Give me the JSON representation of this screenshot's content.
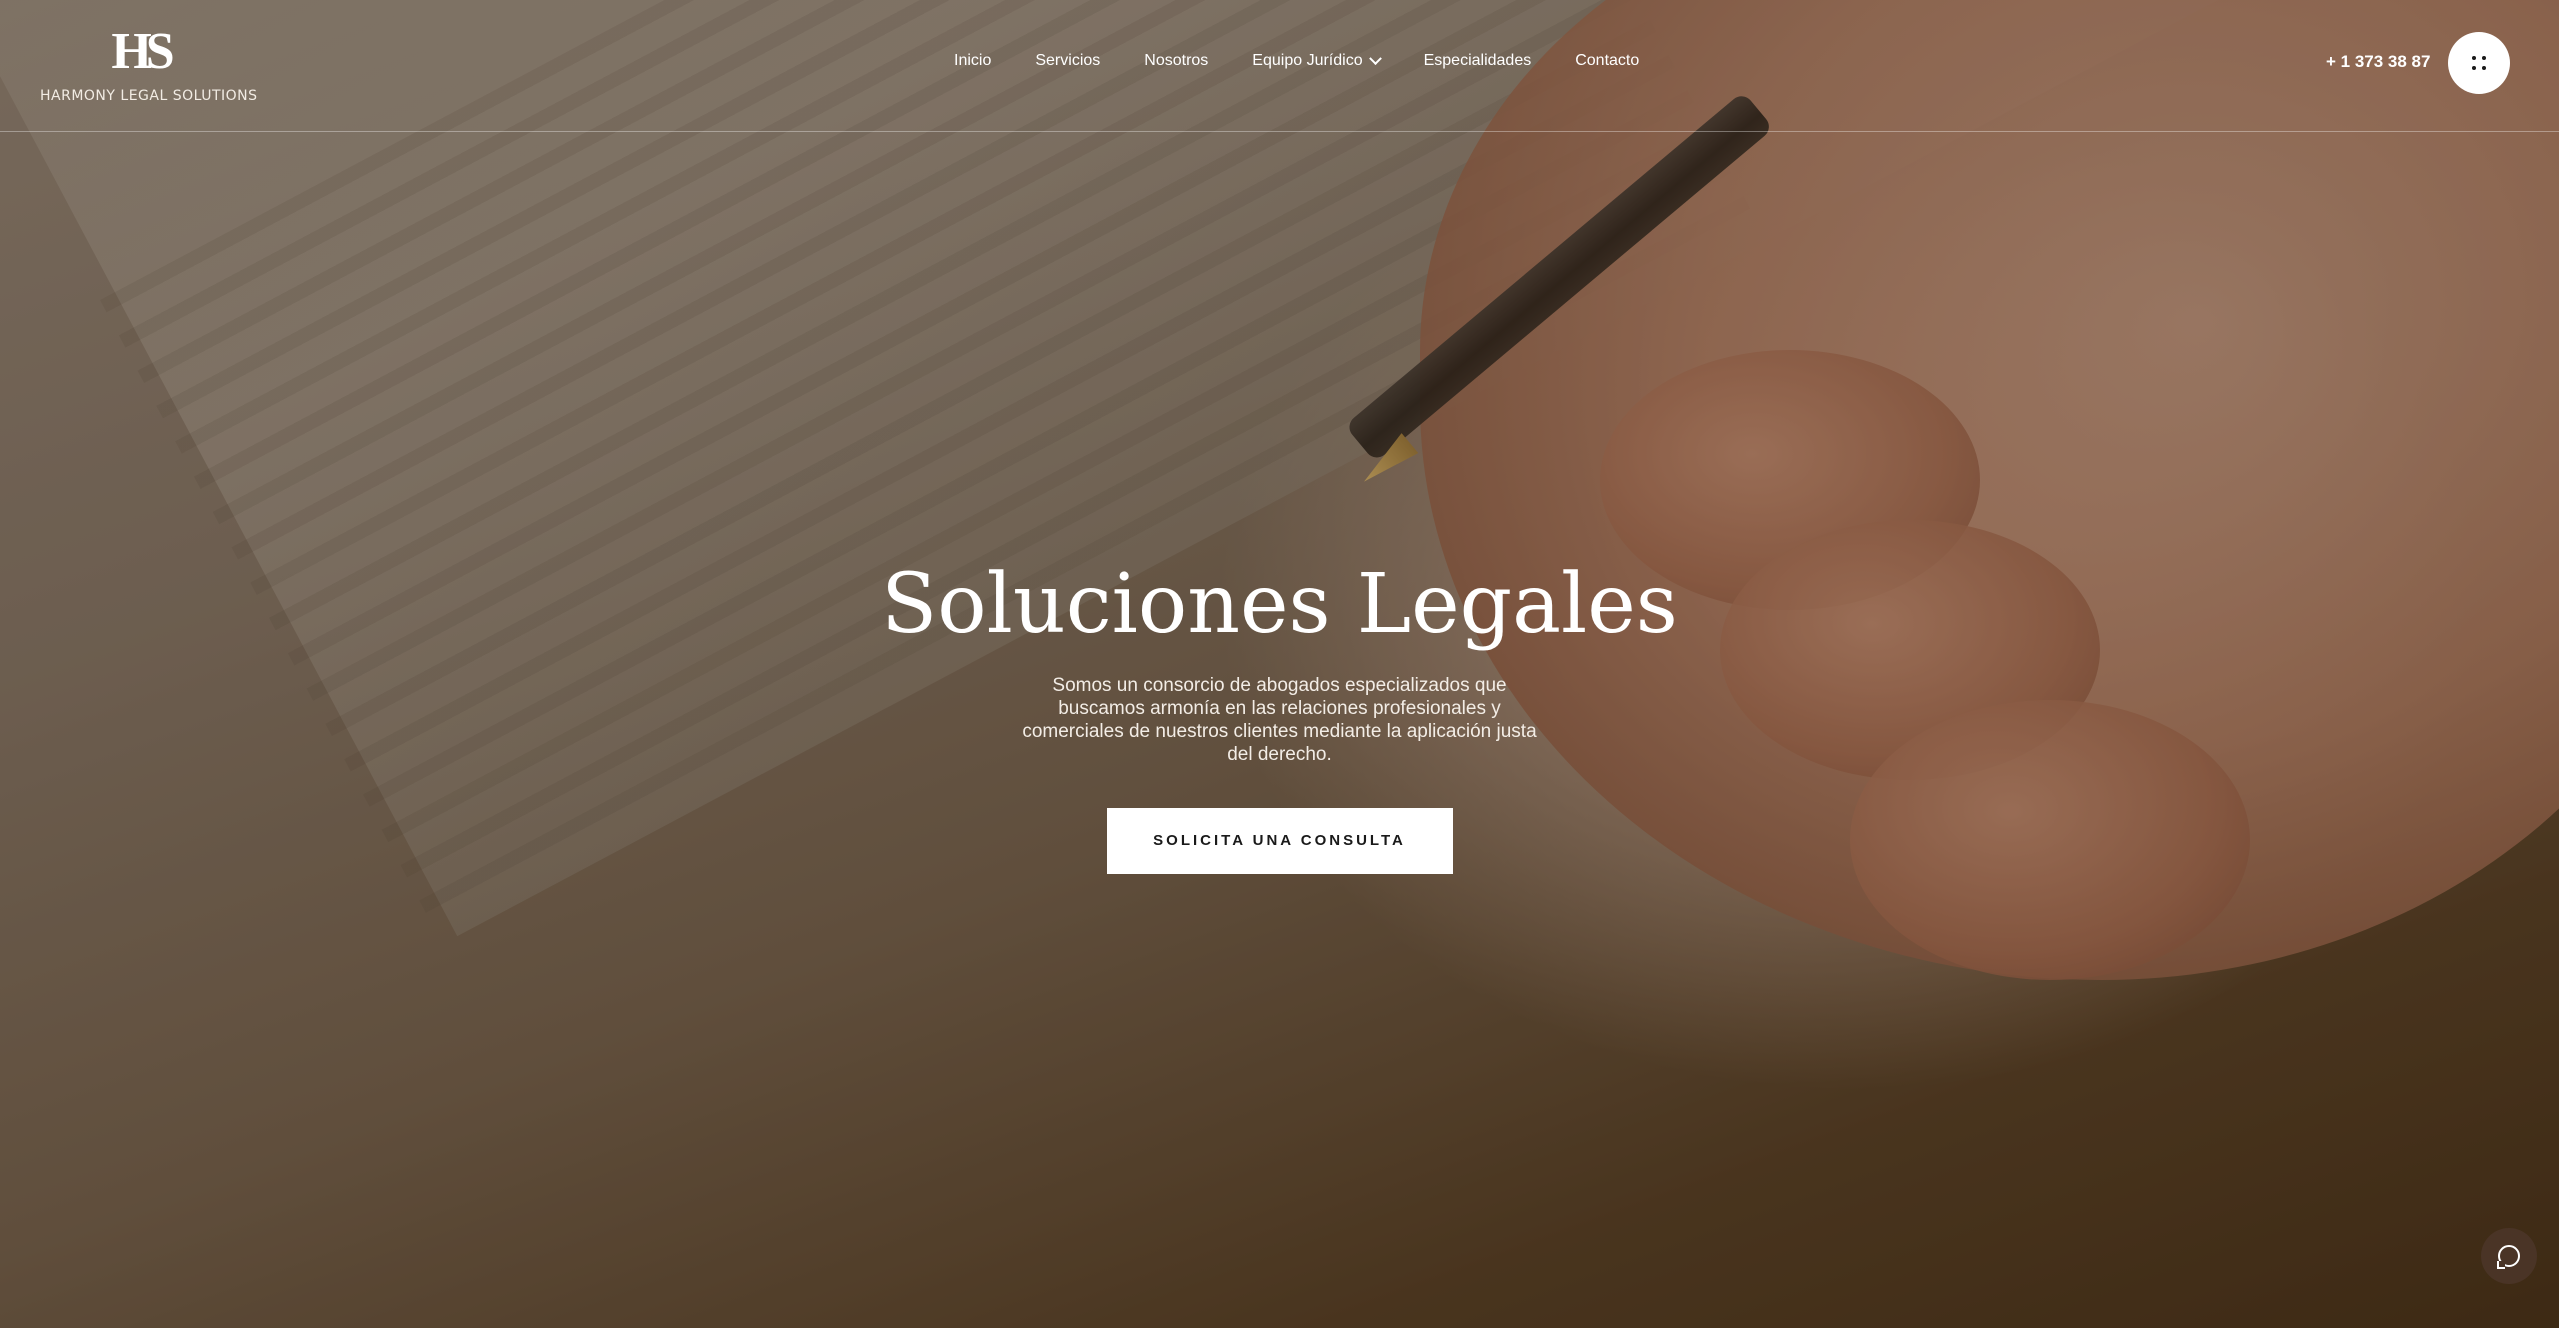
{
  "brand": {
    "logo_mark": "HS",
    "name": "HARMONY LEGAL SOLUTIONS"
  },
  "nav": {
    "items": [
      {
        "label": "Inicio"
      },
      {
        "label": "Servicios"
      },
      {
        "label": "Nosotros"
      },
      {
        "label": "Equipo Jurídico",
        "has_dropdown": true
      },
      {
        "label": "Especialidades"
      },
      {
        "label": "Contacto"
      }
    ]
  },
  "header": {
    "phone": "+ 1 373 38 87",
    "menu_icon": "grid-dots-icon"
  },
  "hero": {
    "title": "Soluciones Legales",
    "subtitle": "Somos un consorcio de abogados especializados que buscamos armonía en las relaciones profesionales y comerciales de nuestros clientes mediante la aplicación justa del derecho.",
    "cta_label": "SOLICITA UNA CONSULTA",
    "background_image": "hand-signing-document-with-fountain-pen"
  },
  "chat": {
    "icon": "chat-bubble-icon"
  },
  "colors": {
    "overlay": "#3c2814",
    "cta_bg": "#ffffff",
    "chat_bg": "#4a3426"
  }
}
